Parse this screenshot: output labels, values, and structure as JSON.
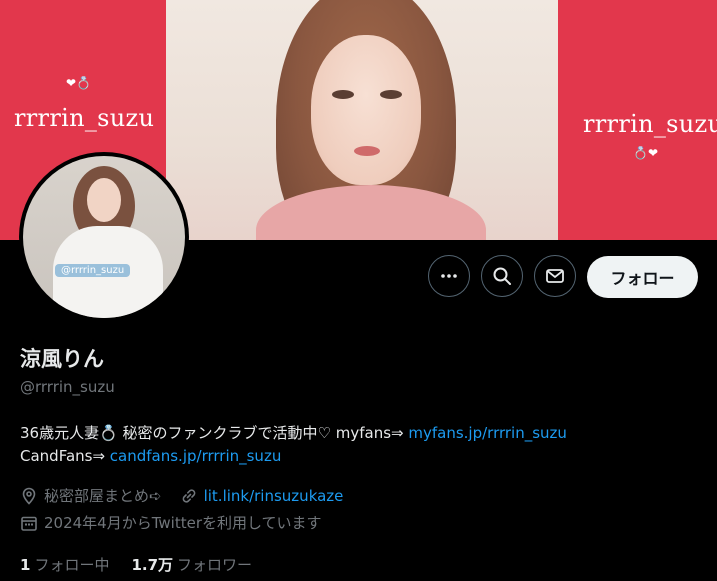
{
  "banner": {
    "left_text": "rrrrin_suzu",
    "right_text": "rrrrin_suzu",
    "ring_left": "❤💍",
    "ring_right": "💍❤"
  },
  "avatar": {
    "tag": "@rrrrin_suzu"
  },
  "actions": {
    "more_icon": "more-dots",
    "search_icon": "search",
    "message_icon": "mail",
    "follow_label": "フォロー"
  },
  "profile": {
    "name": "涼風りん",
    "handle": "@rrrrin_suzu",
    "bio_line1_text": "36歳元人妻💍 秘密のファンクラブで活動中♡ myfans⇒ ",
    "bio_line1_link": "myfans.jp/rrrrin_suzu",
    "bio_line2_text": "CandFans⇒ ",
    "bio_line2_link": "candfans.jp/rrrrin_suzu",
    "location": "秘密部屋まとめ➪",
    "website": "lit.link/rinsuzukaze",
    "joined": "2024年4月からTwitterを利用しています"
  },
  "stats": {
    "following_count": "1",
    "following_label": "フォロー中",
    "followers_count": "1.7万",
    "followers_label": "フォロワー"
  },
  "colors": {
    "banner_bg": "#e2374c",
    "link": "#1d9bf0",
    "muted": "#71767b",
    "text": "#e7e9ea"
  }
}
